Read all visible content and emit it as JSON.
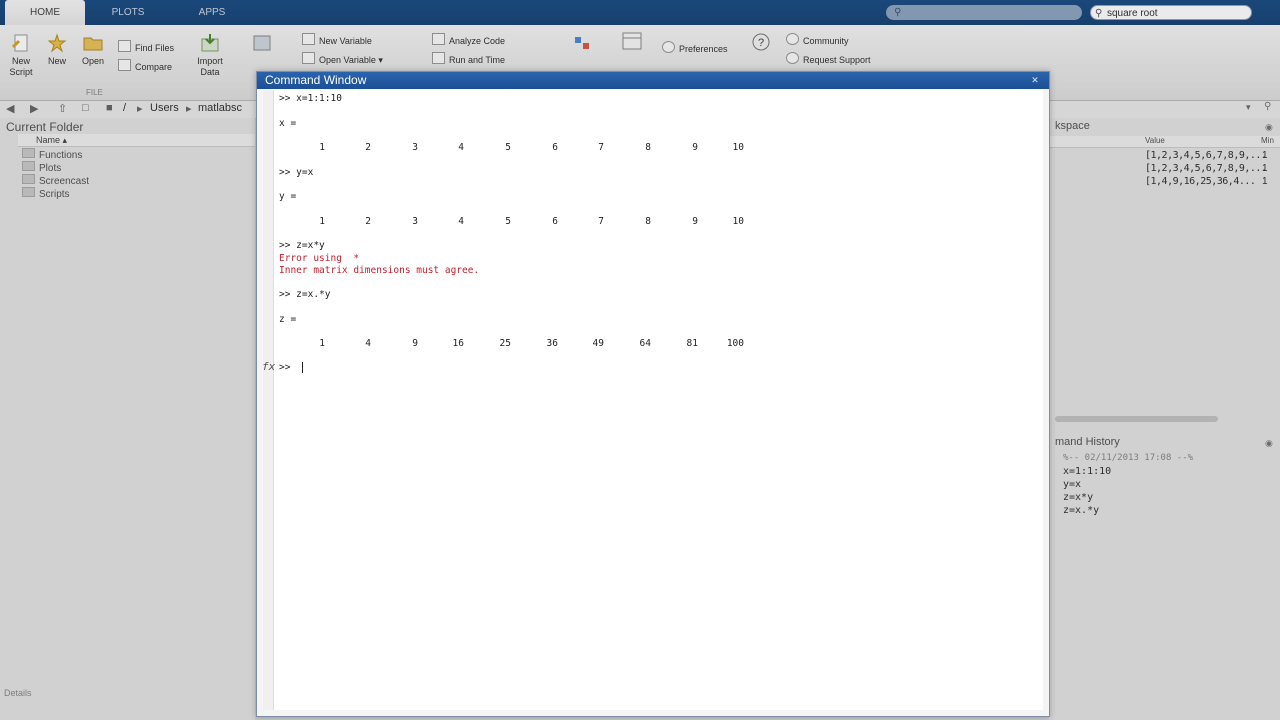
{
  "tabs": [
    "HOME",
    "PLOTS",
    "APPS"
  ],
  "search": {
    "left_placeholder": "",
    "right_value": "square root"
  },
  "toolstrip": {
    "new_script": [
      "New",
      "Script"
    ],
    "new": "New",
    "open": "Open",
    "find_files": "Find Files",
    "compare": "Compare",
    "import_data": [
      "Import",
      "Data"
    ],
    "new_variable": "New Variable",
    "open_variable": "Open Variable",
    "analyze_code": "Analyze Code",
    "run_and_time": "Run and Time",
    "preferences": "Preferences",
    "community": "Community",
    "request_support": "Request Support",
    "file_section": "FILE"
  },
  "address": {
    "path": [
      "/",
      "Users",
      "matlabsc"
    ]
  },
  "current_folder": {
    "title": "Current Folder",
    "column": "Name ▴",
    "items": [
      "Functions",
      "Plots",
      "Screencast",
      "Scripts"
    ],
    "details": "Details"
  },
  "workspace": {
    "title": "kspace",
    "col_value": "Value",
    "col_min": "Min",
    "values": [
      "[1,2,3,4,5,6,7,8,9,...",
      "[1,2,3,4,5,6,7,8,9,...",
      "[1,4,9,16,25,36,4..."
    ],
    "mins": [
      "1",
      "1",
      "1"
    ]
  },
  "history": {
    "title": "mand History",
    "items": [
      "%-- 02/11/2013 17:08 --%",
      "x=1:1:10",
      "y=x",
      "z=x*y",
      "z=x.*y"
    ]
  },
  "command_window": {
    "title": "Command Window",
    "lines": {
      "cmd1": ">> x=1:1:10",
      "x_eq": "x =",
      "cmd2": ">> y=x",
      "y_eq": "y =",
      "cmd3": ">> z=x*y",
      "err1": "Error using  * ",
      "err2": "Inner matrix dimensions must agree.",
      "cmd4": ">> z=x.*y",
      "z_eq": "z =",
      "prompt": ">> ",
      "fx": "fx"
    },
    "x_values": [
      "1",
      "2",
      "3",
      "4",
      "5",
      "6",
      "7",
      "8",
      "9",
      "10"
    ],
    "y_values": [
      "1",
      "2",
      "3",
      "4",
      "5",
      "6",
      "7",
      "8",
      "9",
      "10"
    ],
    "z_values": [
      "1",
      "4",
      "9",
      "16",
      "25",
      "36",
      "49",
      "64",
      "81",
      "100"
    ]
  }
}
